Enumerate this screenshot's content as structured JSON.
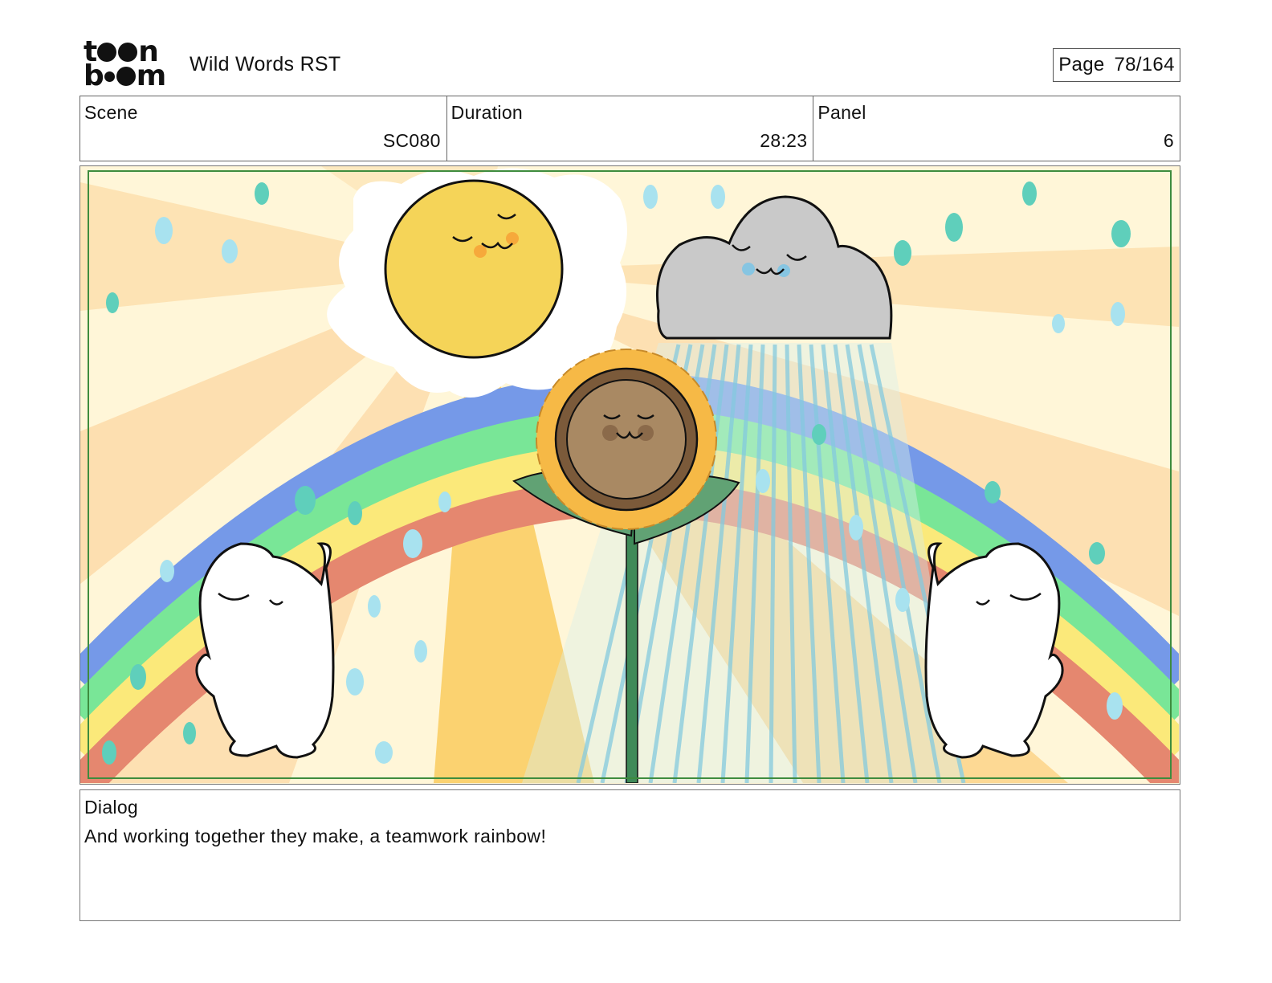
{
  "header": {
    "logo_top": "t  n",
    "logo_bottom": "b  m",
    "project_title": "Wild Words RST",
    "page_label": "Page",
    "page_value": "78/164"
  },
  "info": {
    "scene_label": "Scene",
    "scene_value": "SC080",
    "duration_label": "Duration",
    "duration_value": "28:23",
    "panel_label": "Panel",
    "panel_value": "6"
  },
  "dialog": {
    "label": "Dialog",
    "text": "And working together they make, a teamwork rainbow!"
  },
  "colors": {
    "rainbow_blue": "#7599e8",
    "rainbow_green": "#79e697",
    "rainbow_yellow": "#fbe97a",
    "rainbow_red": "#e5876f",
    "sun": "#f5d458",
    "cloud": "#c9c9c9",
    "sunflower_face": "#a98963",
    "petal": "#f6b946",
    "leaf": "#61a274",
    "raindrop_teal": "#5fcfbb",
    "raindrop_blue": "#a8e2ef",
    "safe_frame": "#3e8c3e"
  }
}
